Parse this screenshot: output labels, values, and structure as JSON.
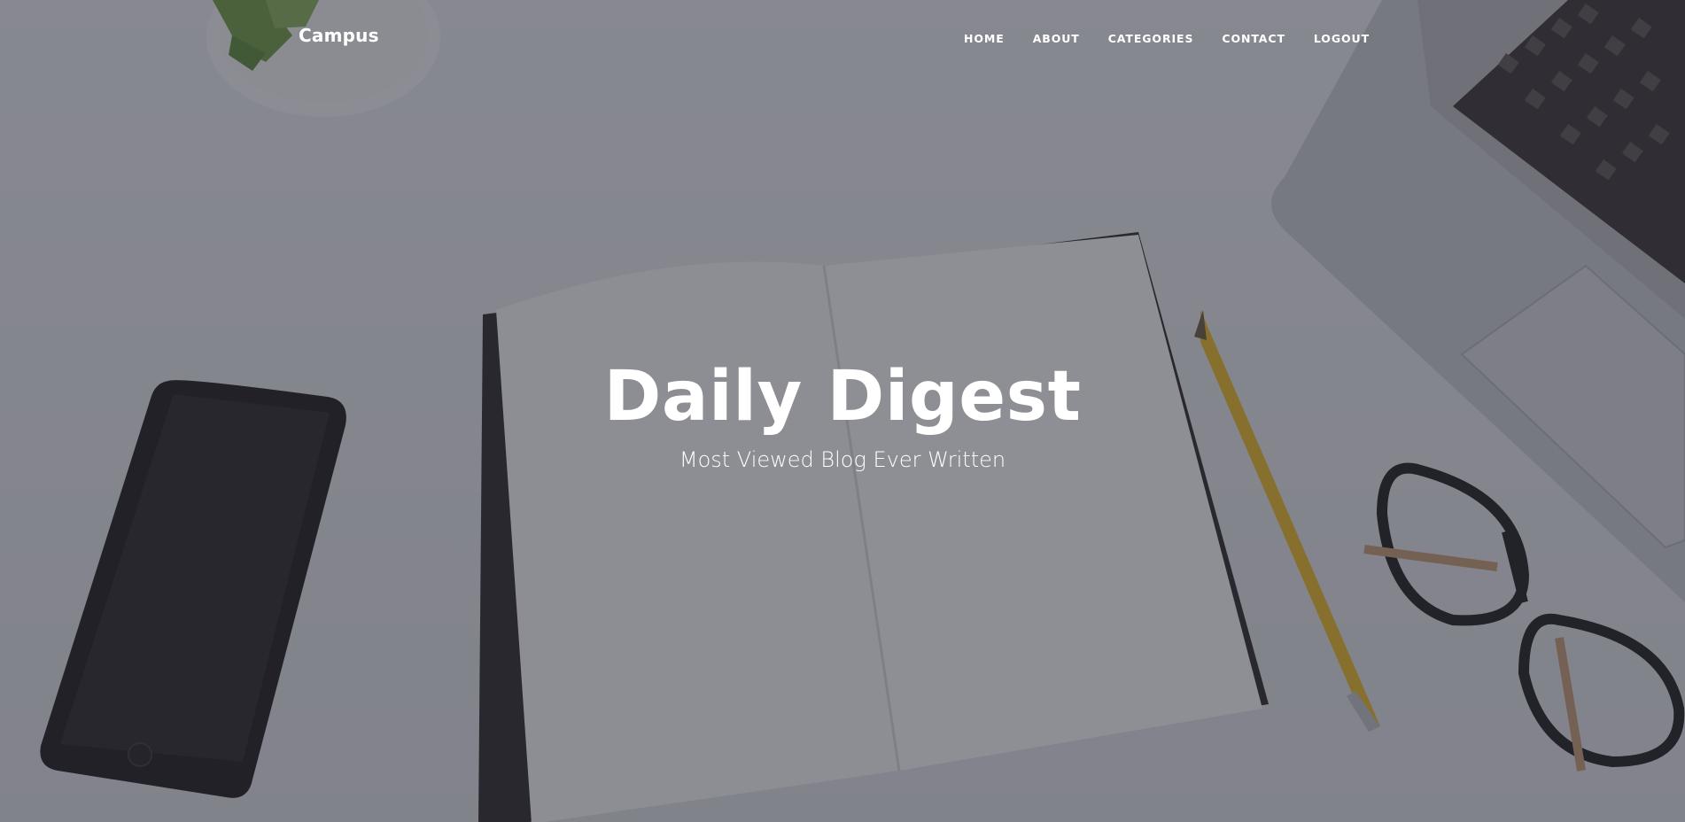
{
  "navbar": {
    "brand": "Campus",
    "links": [
      {
        "label": "HOME"
      },
      {
        "label": "ABOUT"
      },
      {
        "label": "CATEGORIES"
      },
      {
        "label": "CONTACT"
      },
      {
        "label": "LOGOUT"
      }
    ]
  },
  "hero": {
    "title": "Daily Digest",
    "subtitle": "Most Viewed Blog Ever Written",
    "overlay_color": "#26283280"
  }
}
